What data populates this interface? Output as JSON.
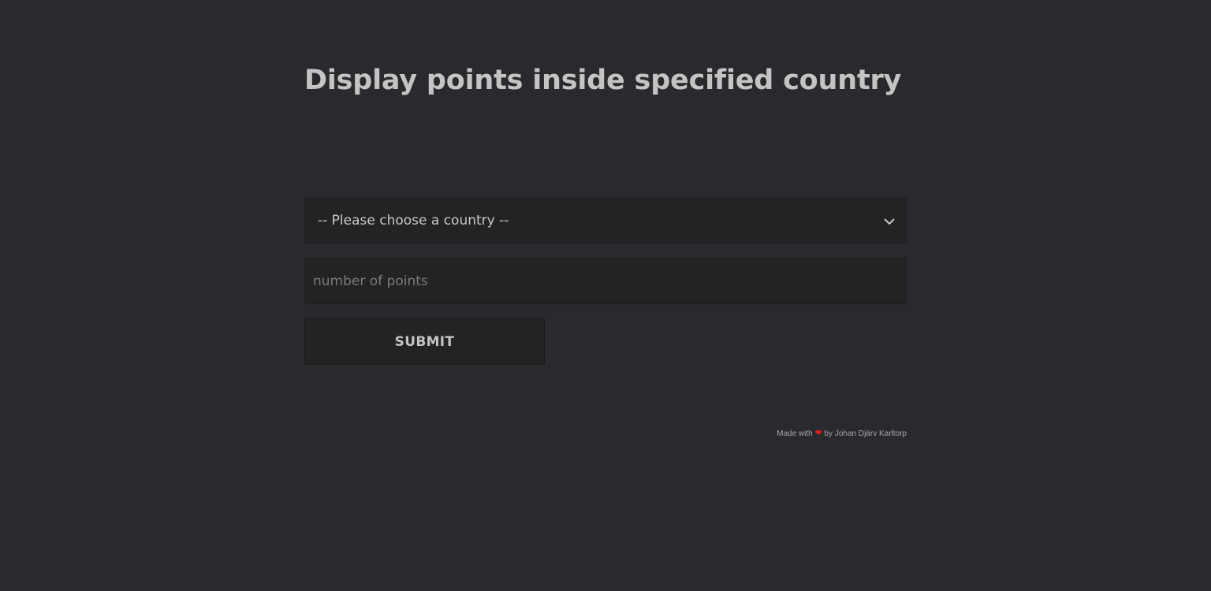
{
  "page": {
    "title": "Display points inside specified country"
  },
  "form": {
    "country_select": {
      "selected": "-- Please choose a country --"
    },
    "points_input": {
      "value": "",
      "placeholder": "number of points"
    },
    "submit_label": "SUBMIT"
  },
  "footer": {
    "made_with": "Made with",
    "heart_icon": "heart-icon",
    "by": "by Johan Djärv Karltorp"
  },
  "colors": {
    "background": "#292a2d",
    "field": "#232323",
    "text": "#c4c4c4",
    "heart": "#e0201a"
  }
}
